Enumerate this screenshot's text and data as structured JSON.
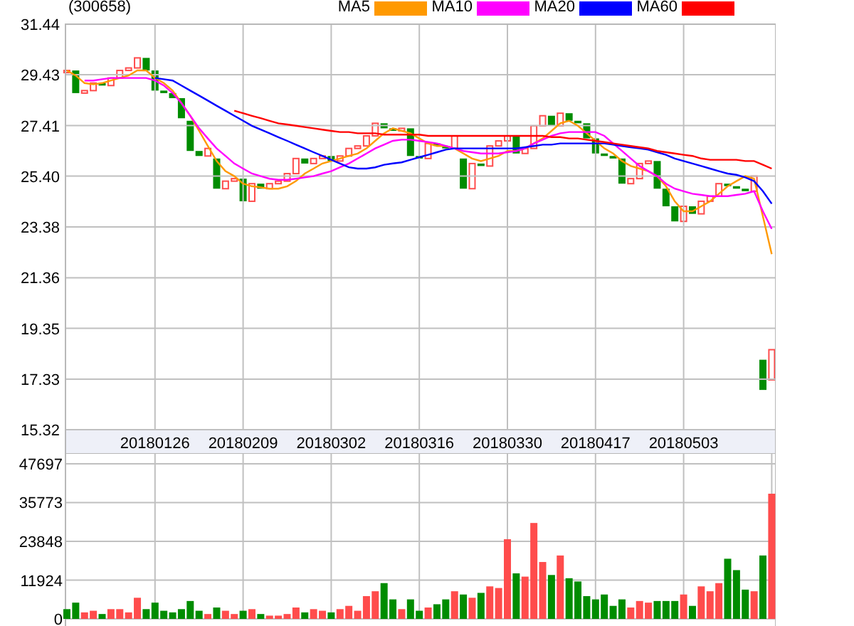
{
  "price_panel": {
    "chart_data": {
      "type": "line",
      "title": "(300658)",
      "grid": true,
      "categories": [
        null,
        null,
        null,
        null,
        null,
        null,
        null,
        null,
        null,
        null,
        "20180126",
        null,
        null,
        null,
        null,
        null,
        null,
        null,
        null,
        null,
        "20180209",
        null,
        null,
        null,
        null,
        null,
        null,
        null,
        null,
        null,
        "20180302",
        null,
        null,
        null,
        null,
        null,
        null,
        null,
        null,
        null,
        "20180316",
        null,
        null,
        null,
        null,
        null,
        null,
        null,
        null,
        null,
        "20180330",
        null,
        null,
        null,
        null,
        null,
        null,
        null,
        null,
        null,
        "20180417",
        null,
        null,
        null,
        null,
        null,
        null,
        null,
        null,
        null,
        "20180503",
        null,
        null,
        null,
        null,
        null,
        null,
        null,
        null,
        null,
        null
      ],
      "ylim": [
        15.32,
        31.44
      ],
      "yticks": [
        {
          "value": 15.32,
          "label": "15.32"
        },
        {
          "value": 17.33,
          "label": "17.33"
        },
        {
          "value": 19.35,
          "label": "19.35"
        },
        {
          "value": 21.36,
          "label": "21.36"
        },
        {
          "value": 23.38,
          "label": "23.38"
        },
        {
          "value": 25.4,
          "label": "25.40"
        },
        {
          "value": 27.41,
          "label": "27.41"
        },
        {
          "value": 29.43,
          "label": "29.43"
        },
        {
          "value": 31.44,
          "label": "31.44"
        }
      ],
      "series": [
        {
          "name": "MA5",
          "color": "#ff9900",
          "values": [
            29.6,
            29.4,
            29.1,
            29.05,
            29.1,
            29.2,
            29.3,
            29.4,
            29.6,
            29.6,
            29.3,
            29.1,
            28.8,
            28.3,
            27.8,
            27.2,
            26.6,
            26.0,
            25.6,
            25.4,
            25.1,
            25.0,
            24.95,
            24.9,
            24.9,
            25.0,
            25.2,
            25.5,
            25.7,
            25.9,
            26.0,
            26.1,
            26.2,
            26.3,
            26.5,
            26.8,
            27.1,
            27.3,
            27.2,
            27.1,
            26.9,
            26.7,
            26.6,
            26.6,
            26.5,
            26.3,
            26.1,
            26.0,
            26.1,
            26.2,
            26.4,
            26.4,
            26.5,
            26.7,
            26.9,
            27.2,
            27.5,
            27.6,
            27.4,
            27.1,
            26.8,
            26.5,
            26.3,
            26.0,
            25.8,
            25.7,
            25.6,
            25.4,
            25.0,
            24.4,
            24.0,
            24.0,
            24.2,
            24.4,
            24.7,
            25.0,
            25.2,
            25.4,
            25.3,
            23.8,
            22.3
          ]
        },
        {
          "name": "MA10",
          "color": "#ff00ff",
          "values": [
            null,
            null,
            29.2,
            29.2,
            29.25,
            29.3,
            29.3,
            29.3,
            29.3,
            29.3,
            29.2,
            29.0,
            28.7,
            28.3,
            27.8,
            27.3,
            26.9,
            26.5,
            26.2,
            25.9,
            25.7,
            25.5,
            25.4,
            25.3,
            25.25,
            25.25,
            25.3,
            25.35,
            25.4,
            25.5,
            25.6,
            25.75,
            25.9,
            26.1,
            26.3,
            26.5,
            26.65,
            26.8,
            26.85,
            26.85,
            26.8,
            26.75,
            26.7,
            26.6,
            26.5,
            26.4,
            26.35,
            26.3,
            26.3,
            26.3,
            26.35,
            26.4,
            26.5,
            26.7,
            26.85,
            27.0,
            27.1,
            27.15,
            27.15,
            27.15,
            27.15,
            27.0,
            26.7,
            26.4,
            26.1,
            25.8,
            25.6,
            25.4,
            25.1,
            24.9,
            24.8,
            24.7,
            24.65,
            24.6,
            24.6,
            24.6,
            24.65,
            24.7,
            24.8,
            24.0,
            23.3
          ]
        },
        {
          "name": "MA20",
          "color": "#0000ff",
          "values": [
            null,
            null,
            null,
            null,
            null,
            null,
            null,
            null,
            null,
            null,
            29.3,
            29.25,
            29.2,
            29.0,
            28.8,
            28.6,
            28.4,
            28.2,
            28.0,
            27.8,
            27.6,
            27.4,
            27.25,
            27.1,
            26.95,
            26.8,
            26.65,
            26.5,
            26.35,
            26.2,
            26.05,
            25.9,
            25.75,
            25.7,
            25.7,
            25.75,
            25.85,
            25.9,
            25.95,
            26.05,
            26.15,
            26.25,
            26.35,
            26.45,
            26.5,
            26.5,
            26.5,
            26.5,
            26.5,
            26.5,
            26.5,
            26.5,
            26.55,
            26.6,
            26.65,
            26.65,
            26.7,
            26.7,
            26.7,
            26.7,
            26.7,
            26.7,
            26.65,
            26.6,
            26.55,
            26.5,
            26.45,
            26.35,
            26.25,
            26.1,
            26.0,
            25.9,
            25.8,
            25.7,
            25.6,
            25.5,
            25.45,
            25.35,
            25.2,
            24.8,
            24.3
          ]
        },
        {
          "name": "MA60",
          "color": "#ff0000",
          "values": [
            null,
            null,
            null,
            null,
            null,
            null,
            null,
            null,
            null,
            null,
            null,
            null,
            null,
            null,
            null,
            null,
            null,
            null,
            null,
            28.0,
            27.9,
            27.8,
            27.7,
            27.6,
            27.5,
            27.45,
            27.4,
            27.35,
            27.3,
            27.25,
            27.2,
            27.15,
            27.15,
            27.1,
            27.1,
            27.1,
            27.05,
            27.05,
            27.05,
            27.05,
            27.05,
            27.0,
            27.0,
            27.0,
            27.0,
            27.0,
            27.0,
            27.0,
            27.0,
            27.0,
            27.0,
            27.0,
            27.0,
            27.0,
            27.0,
            26.95,
            26.95,
            26.9,
            26.9,
            26.85,
            26.8,
            26.75,
            26.7,
            26.65,
            26.6,
            26.55,
            26.5,
            26.4,
            26.35,
            26.3,
            26.25,
            26.2,
            26.1,
            26.05,
            26.05,
            26.05,
            26.05,
            26.0,
            26.0,
            25.85,
            25.7
          ]
        }
      ]
    }
  },
  "volume_panel": {
    "chart_data": {
      "type": "bar",
      "stacked": true,
      "grid": true,
      "categories": [
        null,
        null,
        null,
        null,
        null,
        null,
        null,
        null,
        null,
        null,
        null,
        null,
        null,
        null,
        null,
        null,
        null,
        null,
        null,
        null,
        null,
        null,
        null,
        null,
        null,
        null,
        null,
        null,
        null,
        null,
        null,
        null,
        null,
        null,
        null,
        null,
        null,
        null,
        null,
        null,
        null,
        null,
        null,
        null,
        null,
        null,
        null,
        null,
        null,
        null,
        null,
        null,
        null,
        null,
        null,
        null,
        null,
        null,
        null,
        null,
        null,
        null,
        null,
        null,
        null,
        null,
        null,
        null,
        null,
        null,
        null,
        null,
        null,
        null,
        null,
        null,
        null,
        null,
        null,
        null,
        null
      ],
      "ylim": [
        0,
        47697
      ],
      "yticks": [
        {
          "value": 0,
          "label": "0"
        },
        {
          "value": 11924,
          "label": "11924"
        },
        {
          "value": 23848,
          "label": "23848"
        },
        {
          "value": 35773,
          "label": "35773"
        },
        {
          "value": 47697,
          "label": "47697"
        }
      ],
      "series": [
        {
          "color": "#ff4c4c",
          "values": [
            null,
            null,
            2000,
            2500,
            null,
            3000,
            3000,
            2000,
            6500,
            null,
            null,
            null,
            null,
            null,
            null,
            null,
            1500,
            null,
            2500,
            1500,
            null,
            3000,
            null,
            1000,
            1000,
            1500,
            3500,
            null,
            3000,
            2500,
            null,
            3000,
            4000,
            2500,
            7000,
            8500,
            null,
            null,
            3000,
            null,
            null,
            3500,
            null,
            null,
            8500,
            null,
            6500,
            null,
            10000,
            9500,
            24500,
            null,
            13000,
            29500,
            17500,
            null,
            19500,
            null,
            null,
            null,
            null,
            null,
            null,
            null,
            3500,
            5500,
            5000,
            null,
            null,
            null,
            7500,
            null,
            10000,
            8500,
            11000,
            null,
            null,
            null,
            8500,
            null,
            38500
          ]
        },
        {
          "color": "#008c00",
          "values": [
            3000,
            5000,
            null,
            null,
            1500,
            null,
            null,
            null,
            null,
            3000,
            5000,
            2500,
            2000,
            3000,
            5500,
            2500,
            null,
            3500,
            null,
            null,
            2500,
            null,
            1500,
            null,
            null,
            null,
            null,
            2000,
            null,
            null,
            2000,
            null,
            null,
            null,
            null,
            null,
            11000,
            6000,
            null,
            6000,
            2500,
            null,
            4500,
            6000,
            null,
            7500,
            null,
            8000,
            null,
            null,
            null,
            14000,
            null,
            null,
            null,
            13500,
            null,
            12500,
            11500,
            7000,
            6000,
            7500,
            4000,
            6000,
            null,
            null,
            null,
            5500,
            5500,
            5500,
            null,
            4000,
            null,
            null,
            null,
            18500,
            15000,
            9000,
            null,
            19500,
            null
          ]
        }
      ]
    }
  }
}
